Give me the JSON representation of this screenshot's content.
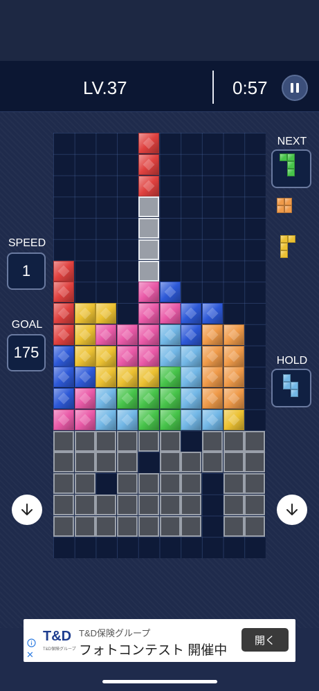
{
  "header": {
    "level": "LV.37",
    "timer": "0:57"
  },
  "sidebar": {
    "speed_label": "SPEED",
    "speed_value": "1",
    "goal_label": "GOAL",
    "goal_value": "175",
    "next_label": "NEXT",
    "hold_label": "HOLD"
  },
  "colors": {
    "R": "#e0413f",
    "Y": "#ecc132",
    "P": "#ea5aa8",
    "B": "#2d59d8",
    "C": "#72b7e6",
    "G": "#47c44a",
    "O": "#ef9a49"
  },
  "board": {
    "columns": 10,
    "rows": 20,
    "cells": [
      "....R.....",
      "....R.....",
      "....R.....",
      "....W.....",
      "....W.....",
      "....W.....",
      "R...W.....",
      "R...PB....",
      "RYY.PPBB..",
      "RYPPPCBOO.",
      "BYYPPCCOO.",
      "BBYYYGCOO.",
      "BPCGGGCOO.",
      "PPCCGGCCY.",
      "XXXXXX.XXX",
      "XXXX.XXXXX",
      "XX.XXXX.XX",
      "XXXXXXX.XX",
      "XXXXXXX.XX",
      "..........",
      ".........."
    ]
  },
  "next_pieces": [
    {
      "name": "next-piece-1",
      "color": "G",
      "blocks": [
        [
          0,
          0
        ],
        [
          1,
          0
        ],
        [
          1,
          1
        ],
        [
          1,
          2
        ]
      ]
    },
    {
      "name": "next-piece-2",
      "color": "O",
      "blocks": [
        [
          0,
          0
        ],
        [
          1,
          0
        ],
        [
          0,
          1
        ],
        [
          1,
          1
        ]
      ]
    },
    {
      "name": "next-piece-3",
      "color": "Y",
      "blocks": [
        [
          0,
          0
        ],
        [
          1,
          0
        ],
        [
          0,
          1
        ],
        [
          0,
          2
        ]
      ]
    }
  ],
  "hold_piece": {
    "color": "C",
    "blocks": [
      [
        0,
        0
      ],
      [
        0,
        1
      ],
      [
        1,
        1
      ],
      [
        1,
        2
      ]
    ]
  },
  "ad": {
    "logo_text": "T&D",
    "logo_sub": "T&D保険グループ",
    "sponsor": "T&D保険グループ",
    "headline": "フォトコンテスト 開催中",
    "cta": "開く"
  },
  "icons": {
    "pause": "pause-icon",
    "drop_left": "arrow-down-icon",
    "drop_right": "arrow-down-icon",
    "info": "info-icon",
    "close": "close-icon"
  }
}
